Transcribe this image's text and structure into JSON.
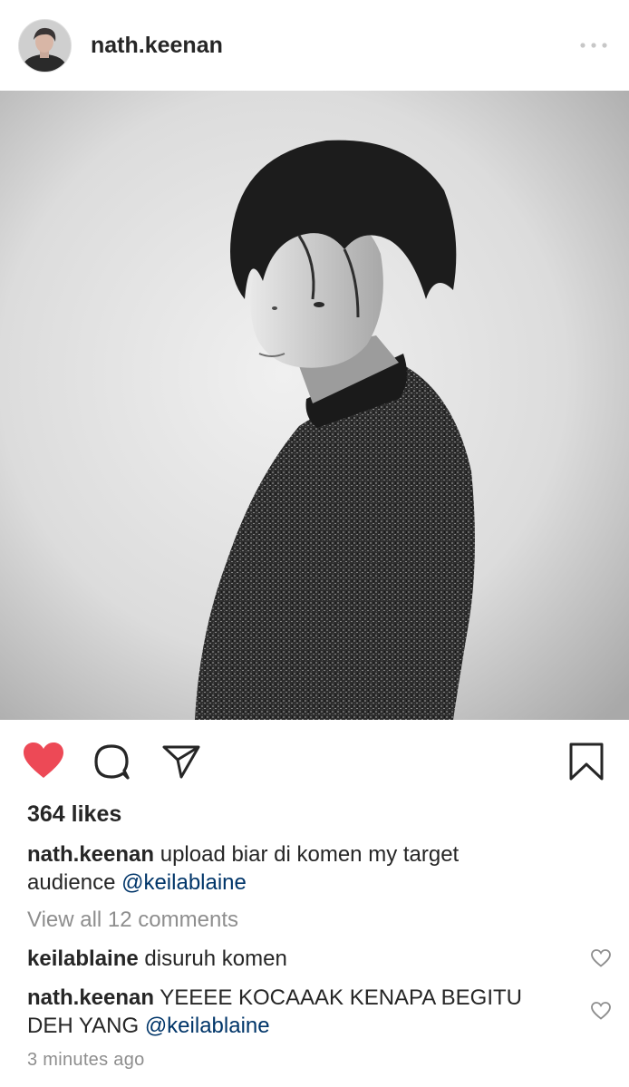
{
  "post": {
    "username": "nath.keenan",
    "likes_text": "364 likes",
    "liked": true,
    "caption": {
      "username": "nath.keenan",
      "text": "upload biar di komen my target audience",
      "mention": "@keilablaine"
    },
    "view_all_comments": "View all 12 comments",
    "comments": [
      {
        "username": "keilablaine",
        "text": "disuruh komen",
        "mention": ""
      },
      {
        "username": "nath.keenan",
        "text": "YEEEE KOCAAAK KENAPA BEGITU DEH YANG",
        "mention": "@keilablaine"
      }
    ],
    "timestamp": "3 minutes ago"
  },
  "icons": {
    "more": "more-dots-icon",
    "like": "heart-filled-icon",
    "comment": "comment-bubble-icon",
    "share": "paper-plane-icon",
    "save": "bookmark-icon",
    "comment_like": "heart-outline-icon"
  },
  "colors": {
    "like_red": "#ed4956",
    "mention_blue": "#003569",
    "muted_gray": "#8e8e8e",
    "text": "#262626"
  }
}
